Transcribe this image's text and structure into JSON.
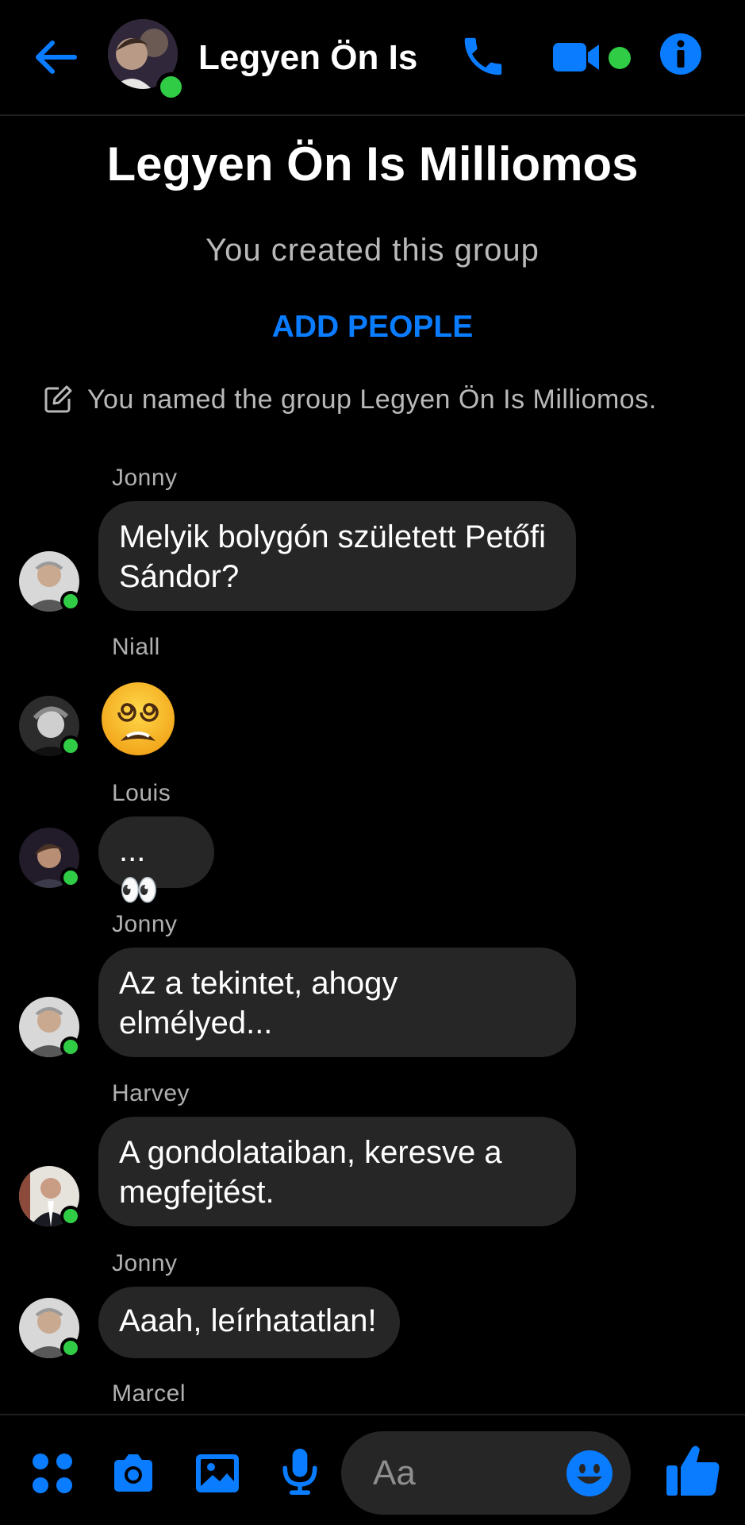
{
  "header": {
    "title": "Legyen Ön Is",
    "accent_color": "#0a7cff",
    "online_color": "#31cc46",
    "icons": [
      "back-arrow-icon",
      "phone-icon",
      "video-camera-icon",
      "info-icon"
    ]
  },
  "group": {
    "title": "Legyen Ön Is Milliomos",
    "created_text": "You created this group",
    "add_people_label": "ADD PEOPLE",
    "named_text": "You named the group Legyen Ön Is Milliomos."
  },
  "messages": [
    {
      "sender": "Jonny",
      "text": "Melyik bolygón született Petőfi Sándor?"
    },
    {
      "sender": "Niall",
      "emoji": "dizzy-face-emoji"
    },
    {
      "sender": "Louis",
      "text": "... 👀"
    },
    {
      "sender": "Jonny",
      "text": "Az a tekintet, ahogy elmélyed..."
    },
    {
      "sender": "Harvey",
      "text": "A gondolataiban, keresve a megfejtést."
    },
    {
      "sender": "Jonny",
      "text": "Aaah, leírhatatlan!"
    },
    {
      "sender": "Marcel"
    }
  ],
  "composer": {
    "placeholder": "Aa",
    "icons": [
      "menu-dots-icon",
      "camera-icon",
      "gallery-icon",
      "microphone-icon",
      "emoji-icon",
      "thumbs-up-icon"
    ]
  }
}
